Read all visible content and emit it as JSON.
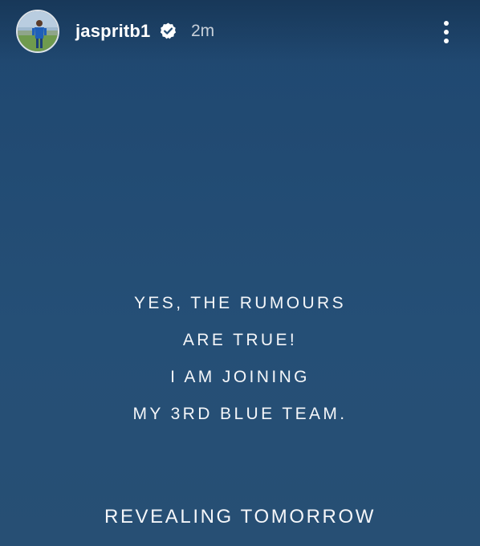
{
  "header": {
    "username": "jaspritb1",
    "verified": true,
    "timestamp": "2m",
    "avatar_icon": "profile-avatar-icon",
    "more_icon": "more-vertical-icon"
  },
  "story": {
    "background_color": "#254d73",
    "lines": [
      "YES, THE RUMOURS",
      "ARE TRUE!",
      "I AM JOINING",
      "MY 3RD BLUE TEAM."
    ],
    "footer": "REVEALING TOMORROW"
  }
}
